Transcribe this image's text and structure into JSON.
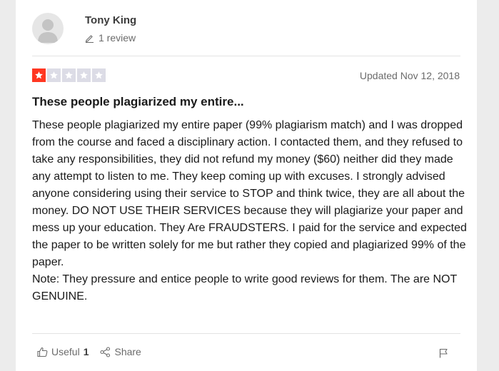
{
  "reviewer": {
    "name": "Tony King",
    "review_count": "1 review"
  },
  "review": {
    "rating": 1,
    "rating_max": 5,
    "rating_color": "#ff3722",
    "empty_star_color": "#dcdce6",
    "updated": "Updated Nov 12, 2018",
    "title": "These people plagiarized my entire...",
    "body_paragraph_1": "These people plagiarized my entire paper (99% plagiarism match) and I was dropped from the course and faced a disciplinary action. I contacted them, and they refused to take any responsibilities, they did not refund my money ($60) neither did they made any attempt to listen to me. They keep coming up with excuses. I strongly advised anyone considering using their service to STOP and think twice, they are all about the money. DO NOT USE THEIR SERVICES because they will plagiarize your paper and mess up your education. They Are FRAUDSTERS. I paid for the service and expected the paper to be written solely for me but rather they copied and plagiarized 99% of the paper.",
    "body_paragraph_2": "Note: They pressure and entice people to write good reviews for them. The are NOT GENUINE."
  },
  "actions": {
    "useful_label": "Useful",
    "useful_count": "1",
    "share_label": "Share"
  },
  "icons": {
    "avatar": "user-avatar-icon",
    "review_count": "pencil-icon",
    "useful": "thumbs-up-icon",
    "share": "share-icon",
    "flag": "flag-icon"
  }
}
